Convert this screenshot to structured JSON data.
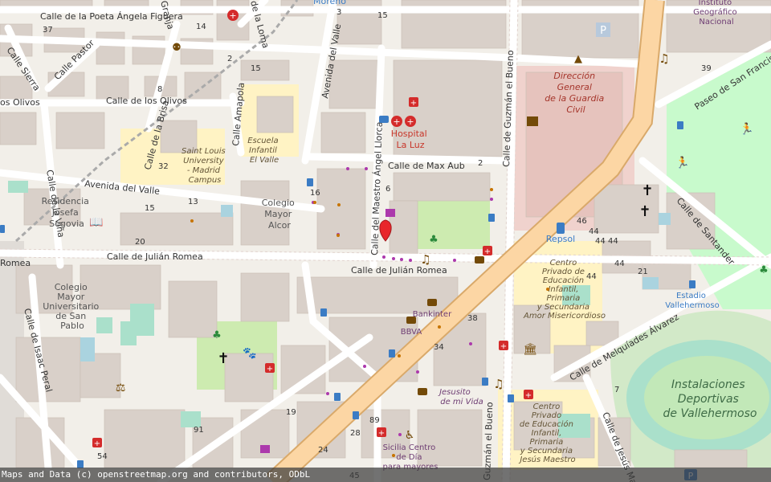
{
  "map": {
    "streets": {
      "poeta_angela_figuera": "Calle de la Poeta Ángela Figuera",
      "sierra": "Calle Sierra",
      "pastor": "Calle Pastor",
      "olivos": "Calle de los Olivos",
      "olivos_left": "os Olivos",
      "brisa": "Calle de la Brisa",
      "amapola": "Calle Amapola",
      "vina": "Calle de la Viña",
      "avenida_valle_h": "Avenida del Valle",
      "avenida_valle_v": "Avenida del Valle",
      "granja": "Granja",
      "la_loma": "de la Loma",
      "maestro_angel_llorca": "Calle del Maestro Ángel Llorca",
      "max_aub": "Calle de Max Aub",
      "guzman_el_bueno": "Calle de Guzmán el Bueno",
      "guzman_el_bueno_lower": "Guzmán el Bueno",
      "julian_romea_left": "Calle de Julián Romea",
      "julian_romea_right": "Calle de Julián Romea",
      "romea_edge": "Romea",
      "isaac_peral": "Calle de Isaac Peral",
      "santander": "Calle de Santander",
      "paseo_san_francisco": "Paseo de San Francisco",
      "melquiades_alvarez": "Calle de Melquíades Álvarez",
      "jesus_maestro": "Calle de Jesús Ma",
      "moreno": "Moreno"
    },
    "places": {
      "direccion_guardia_civil": [
        "Dirección",
        "General",
        "de la Guardia",
        "Civil"
      ],
      "instituto_geografico": [
        "Instituto",
        "Geográfico",
        "Nacional"
      ],
      "hospital_la_luz": [
        "Hospital",
        "La Luz"
      ],
      "escuela_infantil": [
        "Escuela",
        "Infantil",
        "El Valle"
      ],
      "saint_louis": [
        "Saint Louis",
        "University",
        "- Madrid",
        "Campus"
      ],
      "residencia_josefa": [
        "Residencia",
        "Josefa",
        "Segovia"
      ],
      "colegio_mayor_alcor": [
        "Colegio",
        "Mayor",
        "Alcor"
      ],
      "colegio_san_pablo": [
        "Colegio",
        "Mayor",
        "Universitario",
        "de San",
        "Pablo"
      ],
      "repsol": "Repsol",
      "centro_privado_amor": [
        "Centro",
        "Privado de",
        "Educación",
        "Infantil,",
        "Primaria",
        "y Secundaria",
        "Amor Misericordioso"
      ],
      "centro_privado_jesus": [
        "Centro",
        "Privado",
        "de Educación",
        "Infantil,",
        "Primaria",
        "y Secundaria",
        "Jesús Maestro"
      ],
      "estadio": [
        "Estadio",
        "Vallehermoso"
      ],
      "instalaciones": [
        "Instalaciones",
        "Deportivas",
        "de Vallehermoso"
      ],
      "bankinter": "Bankinter",
      "bbva": "BBVA",
      "jesusito": [
        "Jesusito",
        "de mi Vida"
      ],
      "sicilia": [
        "Sicilia Centro",
        "de Día",
        "para mayores"
      ],
      "residencia_edge": "Resid"
    },
    "house_numbers": [
      "37",
      "14",
      "2",
      "15",
      "8",
      "32",
      "13",
      "15",
      "20",
      "16",
      "6",
      "2",
      "15",
      "39",
      "44",
      "44",
      "44",
      "46",
      "44",
      "21",
      "44",
      "38",
      "34",
      "19",
      "91",
      "28",
      "89",
      "24",
      "54",
      "3",
      "45",
      "7"
    ],
    "icons": {
      "hospital": "hospital-icon",
      "church": "church-icon",
      "bank": "bank-icon",
      "library": "library-icon",
      "music": "music-venue-icon",
      "police": "police-icon",
      "fuel": "fuel-icon",
      "bus": "bus-stop-icon",
      "parking": "parking-icon",
      "marker": "location-pin-icon"
    },
    "colors": {
      "background": "#f2efe9",
      "building": "#d9d0c9",
      "main_road": "#fcd6a4",
      "park": "#c8facc",
      "pitch": "#aae0cb",
      "hospital_red": "#e3262c",
      "marker_red": "#e8262b",
      "government": "#f2d3cd",
      "school": "#fff6c6"
    }
  },
  "attribution": "Maps and Data (c) openstreetmap.org and contributors, ODbL"
}
